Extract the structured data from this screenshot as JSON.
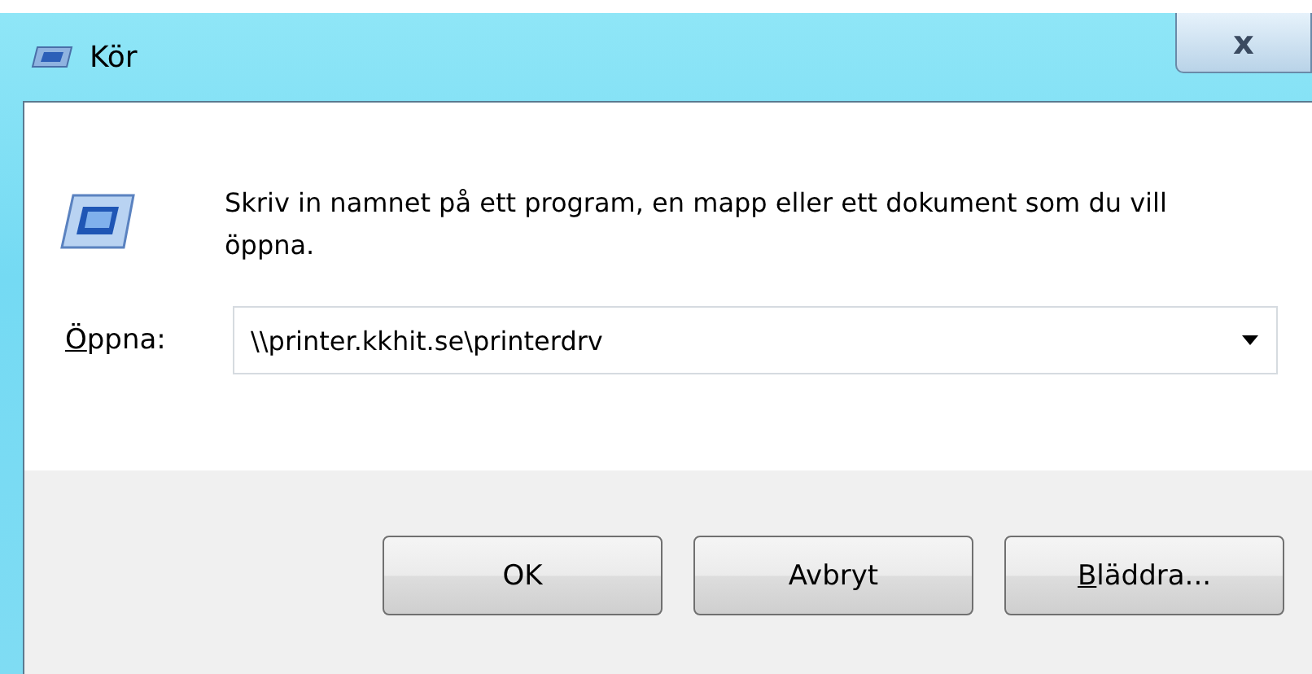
{
  "window": {
    "title": "Kör",
    "close_glyph": "x"
  },
  "prompt": "Skriv in namnet på ett program, en mapp eller ett dokument som du vill öppna.",
  "open_field": {
    "label": "Öppna:",
    "label_access_key_underlined": true,
    "value": "\\\\printer.kkhit.se\\printerdrv"
  },
  "buttons": [
    {
      "label": "OK",
      "access_key_underlined": false
    },
    {
      "label": "Avbryt",
      "access_key_underlined": false
    },
    {
      "label": "Bläddra...",
      "access_key_underlined": true
    }
  ]
}
